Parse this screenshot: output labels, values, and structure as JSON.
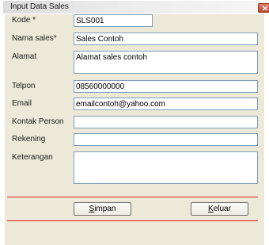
{
  "window": {
    "title": "Input Data Sales",
    "close_symbol": "×"
  },
  "form": {
    "kode": {
      "label": "Kode *",
      "value": "SLS001"
    },
    "nama": {
      "label": "Nama sales*",
      "value": "Sales Contoh"
    },
    "alamat": {
      "label": "Alamat",
      "value": "Alamat sales contoh"
    },
    "telpon": {
      "label": "Telpon",
      "value": "08560000000"
    },
    "email": {
      "label": "Email",
      "value": "emailcontoh@yahoo.com"
    },
    "kontak": {
      "label": "Kontak Person",
      "value": ""
    },
    "rekening": {
      "label": "Rekening",
      "value": ""
    },
    "keterangan": {
      "label": "Keterangan",
      "value": ""
    }
  },
  "buttons": {
    "simpan": {
      "mnemonic": "S",
      "rest": "impan"
    },
    "keluar": {
      "mnemonic": "K",
      "rest": "eluar"
    }
  },
  "colors": {
    "dialog_background": "#ece9d8",
    "field_border": "#7f9db9",
    "separator": "#e02020",
    "close_button": "#c4583f"
  },
  "icons": {
    "close": "close-icon"
  }
}
